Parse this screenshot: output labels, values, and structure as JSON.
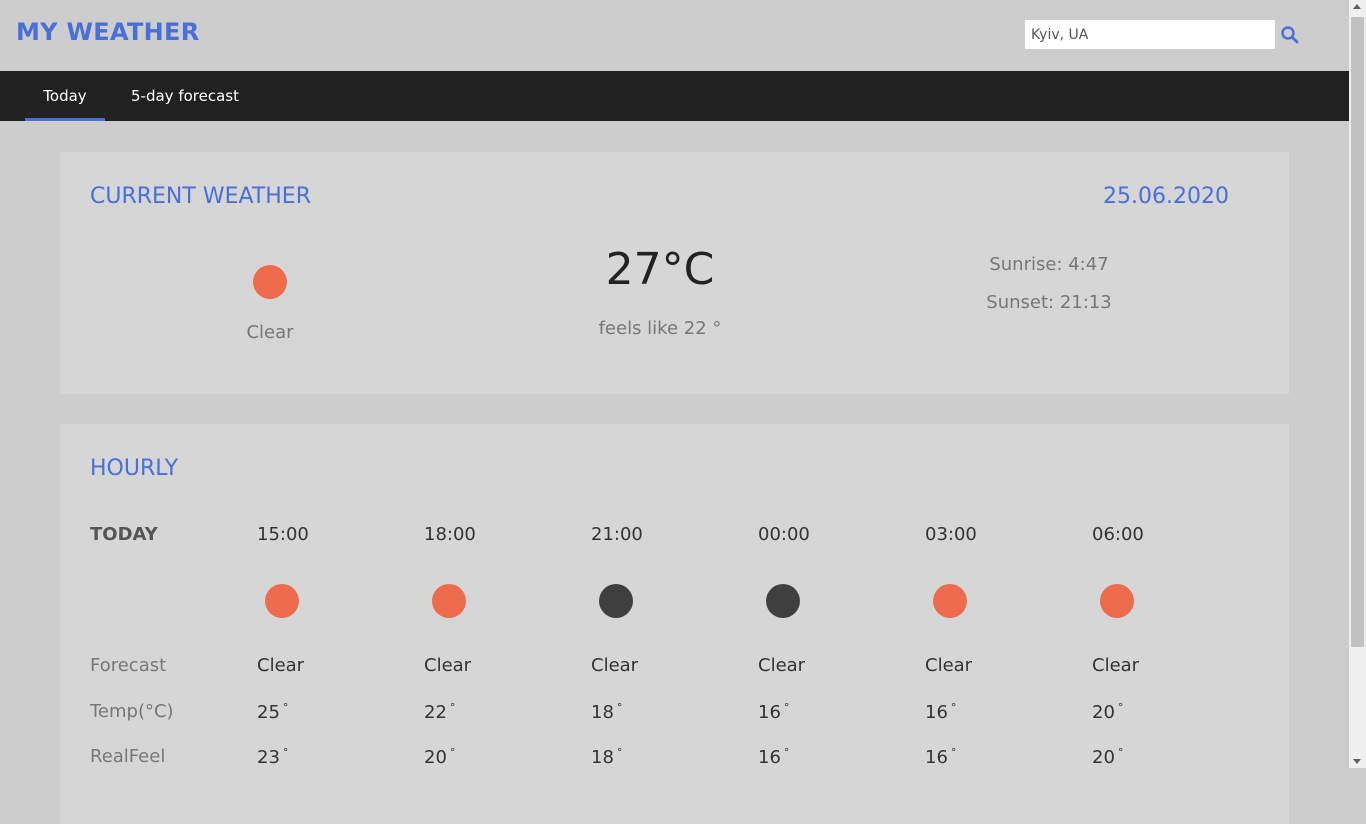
{
  "app": {
    "title": "MY WEATHER"
  },
  "search": {
    "value": "Kyiv, UA",
    "icon": "search-icon"
  },
  "nav": {
    "tabs": [
      {
        "label": "Today",
        "active": true
      },
      {
        "label": "5-day forecast",
        "active": false
      }
    ]
  },
  "current": {
    "title": "CURRENT WEATHER",
    "date": "25.06.2020",
    "icon": "sun-icon",
    "description": "Clear",
    "temperature": "27°C",
    "feels_like": "feels like 22 °",
    "sunrise": "Sunrise: 4:47",
    "sunset": "Sunset: 21:13"
  },
  "hourly": {
    "title": "HOURLY",
    "day_label": "TODAY",
    "row_labels": {
      "forecast": "Forecast",
      "temp": "Temp(°C)",
      "realfeel": "RealFeel"
    },
    "degree_symbol": "°",
    "hours": [
      {
        "time": "15:00",
        "icon": "sun-icon",
        "forecast": "Clear",
        "temp": "25",
        "realfeel": "23"
      },
      {
        "time": "18:00",
        "icon": "sun-icon",
        "forecast": "Clear",
        "temp": "22",
        "realfeel": "20"
      },
      {
        "time": "21:00",
        "icon": "moon-icon",
        "forecast": "Clear",
        "temp": "18",
        "realfeel": "18"
      },
      {
        "time": "00:00",
        "icon": "moon-icon",
        "forecast": "Clear",
        "temp": "16",
        "realfeel": "16"
      },
      {
        "time": "03:00",
        "icon": "sun-icon",
        "forecast": "Clear",
        "temp": "16",
        "realfeel": "16"
      },
      {
        "time": "06:00",
        "icon": "sun-icon",
        "forecast": "Clear",
        "temp": "20",
        "realfeel": "20"
      }
    ]
  },
  "colors": {
    "accent": "#4a6fd8",
    "sun": "#ee6b4d",
    "moon": "#3f3f40",
    "navbar": "#222122"
  }
}
